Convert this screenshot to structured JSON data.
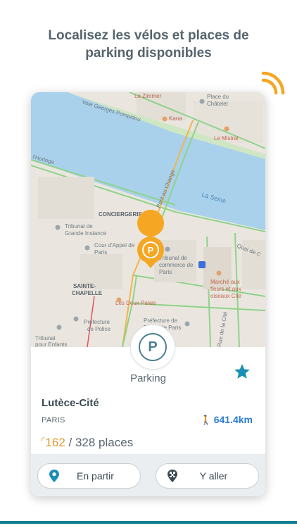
{
  "headline": {
    "line1": "Localisez les vélos et places de",
    "line2": "parking disponibles"
  },
  "map": {
    "labels": {
      "street_pompidou": "Voie Georges Pompidou",
      "horloge": "l'Horloge",
      "le_zimmer": "Le Zimmer",
      "place_chatelet_1": "Place du",
      "place_chatelet_2": "Châtelet",
      "kana": "Kana",
      "le_mistral": "Le Mistral",
      "pont_au_change": "Pont au Change",
      "la_seine": "La Seine",
      "quai": "Quai de C",
      "conciergerie": "CONCIERGERIE",
      "tribunal_gi_1": "Tribunal de",
      "tribunal_gi_2": "Grande Instance",
      "cour_appel_1": "Cour d'Appel de",
      "cour_appel_2": "Paris",
      "tribunal_commerce_1": "Tribunal de",
      "tribunal_commerce_2": "commerce de",
      "tribunal_commerce_3": "Paris",
      "sainte_chapelle_1": "SAINTE-",
      "sainte_chapelle_2": "CHAPELLE",
      "marche_fleurs_1": "Marché aux",
      "marche_fleurs_2": "fleurs et aux",
      "marche_fleurs_3": "oiseaux Cité",
      "deux_palais": "Les Deux Palais",
      "prefecture_police_1": "Préfecture",
      "prefecture_police_2": "de Police",
      "prefecture_paris_1": "Préfecture de",
      "prefecture_paris_2": "Police de Paris",
      "rue_cite": "Rue de la Cité",
      "tribunal_enfants_1": "Tribunal",
      "tribunal_enfants_2": "pour Enfants"
    },
    "marker_letter": "P"
  },
  "station": {
    "badge_letter": "P",
    "type_label": "Parking",
    "name": "Lutèce-Cité",
    "city": "PARIS",
    "walk_icon": "walking-person",
    "distance": "641.4km",
    "available": "162",
    "total_text": " / 328 places"
  },
  "buttons": {
    "depart_label": "En partir",
    "go_label": "Y aller"
  },
  "colors": {
    "accent_orange": "#f5a623",
    "teal": "#0f7f8f",
    "favorite_star": "#1b8fb5",
    "distance_blue": "#2b7dd1"
  }
}
